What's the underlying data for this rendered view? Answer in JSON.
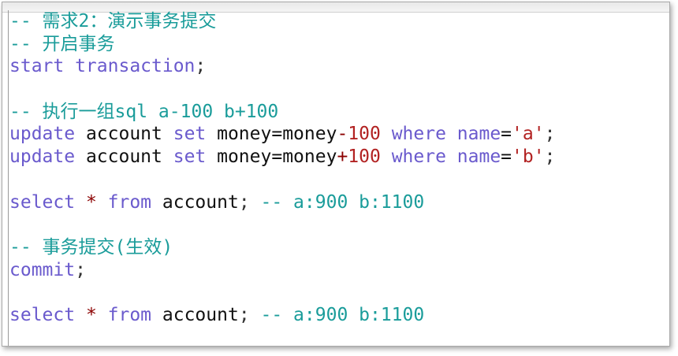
{
  "colors": {
    "comment": "#1a9c9a",
    "keyword": "#6a5acd",
    "identifier": "#111111",
    "operator": "#8b0000",
    "string": "#b22222"
  },
  "lines": [
    {
      "type": "comment",
      "text": "-- 需求2：演示事务提交"
    },
    {
      "type": "comment",
      "text": "-- 开启事务"
    },
    {
      "type": "code",
      "tokens": [
        {
          "k": "kw",
          "v": "start transaction"
        },
        {
          "k": "pu",
          "v": ";"
        }
      ]
    },
    {
      "type": "blank",
      "text": ""
    },
    {
      "type": "comment",
      "text": "-- 执行一组sql a-100 b+100"
    },
    {
      "type": "code",
      "tokens": [
        {
          "k": "kw",
          "v": "update"
        },
        {
          "k": "id",
          "v": " account "
        },
        {
          "k": "kw",
          "v": "set"
        },
        {
          "k": "id",
          "v": " money=money"
        },
        {
          "k": "op",
          "v": "-"
        },
        {
          "k": "num",
          "v": "100"
        },
        {
          "k": "kw",
          "v": " where name"
        },
        {
          "k": "id",
          "v": "="
        },
        {
          "k": "str",
          "v": "'a'"
        },
        {
          "k": "pu",
          "v": ";"
        }
      ]
    },
    {
      "type": "code",
      "tokens": [
        {
          "k": "kw",
          "v": "update"
        },
        {
          "k": "id",
          "v": " account "
        },
        {
          "k": "kw",
          "v": "set"
        },
        {
          "k": "id",
          "v": " money=money"
        },
        {
          "k": "op",
          "v": "+"
        },
        {
          "k": "num",
          "v": "100"
        },
        {
          "k": "kw",
          "v": " where name"
        },
        {
          "k": "id",
          "v": "="
        },
        {
          "k": "str",
          "v": "'b'"
        },
        {
          "k": "pu",
          "v": ";"
        }
      ]
    },
    {
      "type": "blank",
      "text": ""
    },
    {
      "type": "code",
      "tokens": [
        {
          "k": "kw",
          "v": "select"
        },
        {
          "k": "op",
          "v": " * "
        },
        {
          "k": "kw",
          "v": "from"
        },
        {
          "k": "id",
          "v": " account"
        },
        {
          "k": "pu",
          "v": ";"
        },
        {
          "k": "cm",
          "v": " -- a:900 b:1100"
        }
      ]
    },
    {
      "type": "blank",
      "text": ""
    },
    {
      "type": "comment",
      "text": "-- 事务提交(生效)"
    },
    {
      "type": "code",
      "tokens": [
        {
          "k": "kw",
          "v": "commit"
        },
        {
          "k": "pu",
          "v": ";"
        }
      ]
    },
    {
      "type": "blank",
      "text": ""
    },
    {
      "type": "code",
      "tokens": [
        {
          "k": "kw",
          "v": "select"
        },
        {
          "k": "op",
          "v": " * "
        },
        {
          "k": "kw",
          "v": "from"
        },
        {
          "k": "id",
          "v": " account"
        },
        {
          "k": "pu",
          "v": ";"
        },
        {
          "k": "cm",
          "v": " -- a:900 b:1100"
        }
      ]
    }
  ]
}
